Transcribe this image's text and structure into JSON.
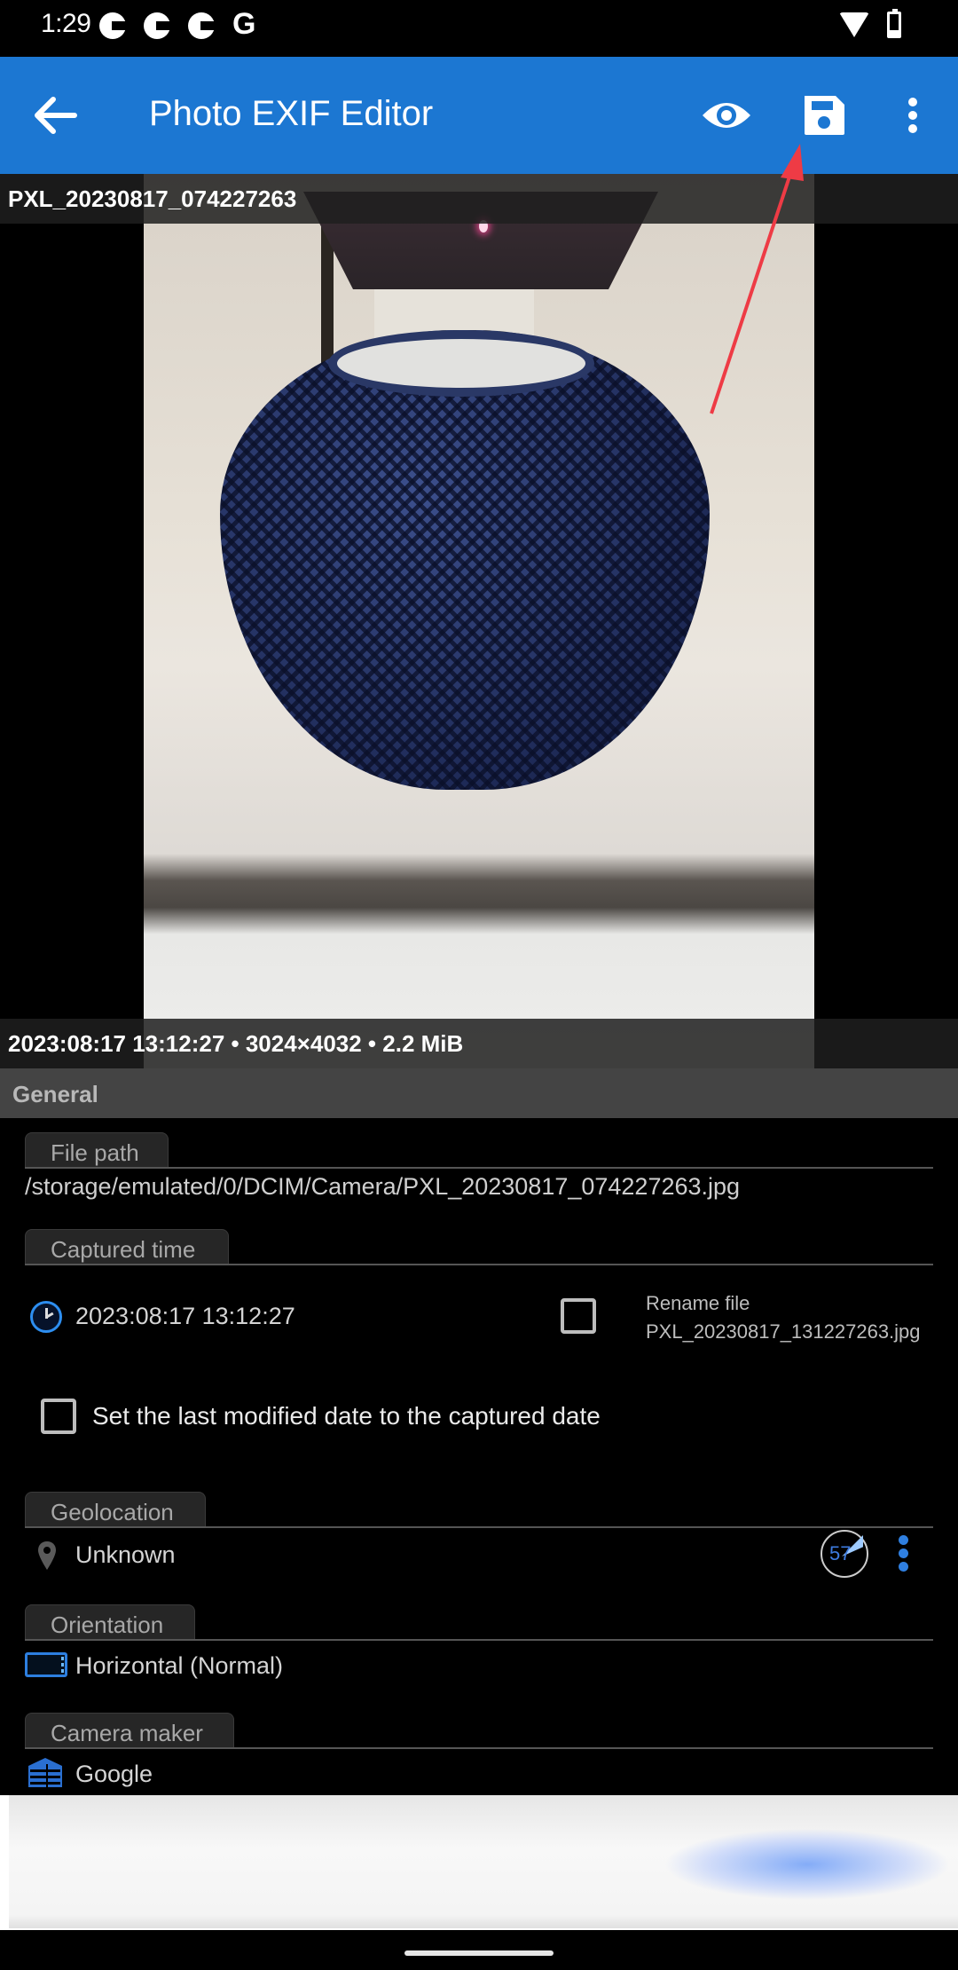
{
  "status_bar": {
    "time": "1:29",
    "notification_icons": [
      "app-notification-icon",
      "app-notification-icon",
      "app-notification-icon",
      "google-icon"
    ],
    "google_glyph": "G",
    "system_icons": [
      "wifi-icon",
      "battery-icon"
    ]
  },
  "app_bar": {
    "title": "Photo EXIF Editor",
    "back_icon": "arrow-left-icon",
    "actions": [
      "eye-icon",
      "save-icon",
      "more-vert-icon"
    ],
    "color": "#1c77d2"
  },
  "photo": {
    "filename": "PXL_20230817_074227263",
    "info": "2023:08:17 13:12:27 • 3024×4032 • 2.2 MiB",
    "annotation_arrow_color": "#ee3b45"
  },
  "general": {
    "section_title": "General",
    "file_path": {
      "label": "File path",
      "value": "/storage/emulated/0/DCIM/Camera/PXL_20230817_074227263.jpg"
    },
    "captured_time": {
      "label": "Captured time",
      "value": "2023:08:17 13:12:27",
      "rename_checked": false,
      "rename_label": "Rename file",
      "rename_filename": "PXL_20230817_131227263.jpg",
      "set_modified_checked": false,
      "set_modified_label": "Set the last modified date to the captured date"
    },
    "geolocation": {
      "label": "Geolocation",
      "value": "Unknown",
      "compass_value": "57"
    },
    "orientation": {
      "label": "Orientation",
      "value": "Horizontal (Normal)"
    },
    "camera_maker": {
      "label": "Camera maker",
      "value": "Google"
    }
  },
  "colors": {
    "accent": "#2d8ef0",
    "section_header_bg": "#444444",
    "field_tab_bg": "#262626"
  }
}
